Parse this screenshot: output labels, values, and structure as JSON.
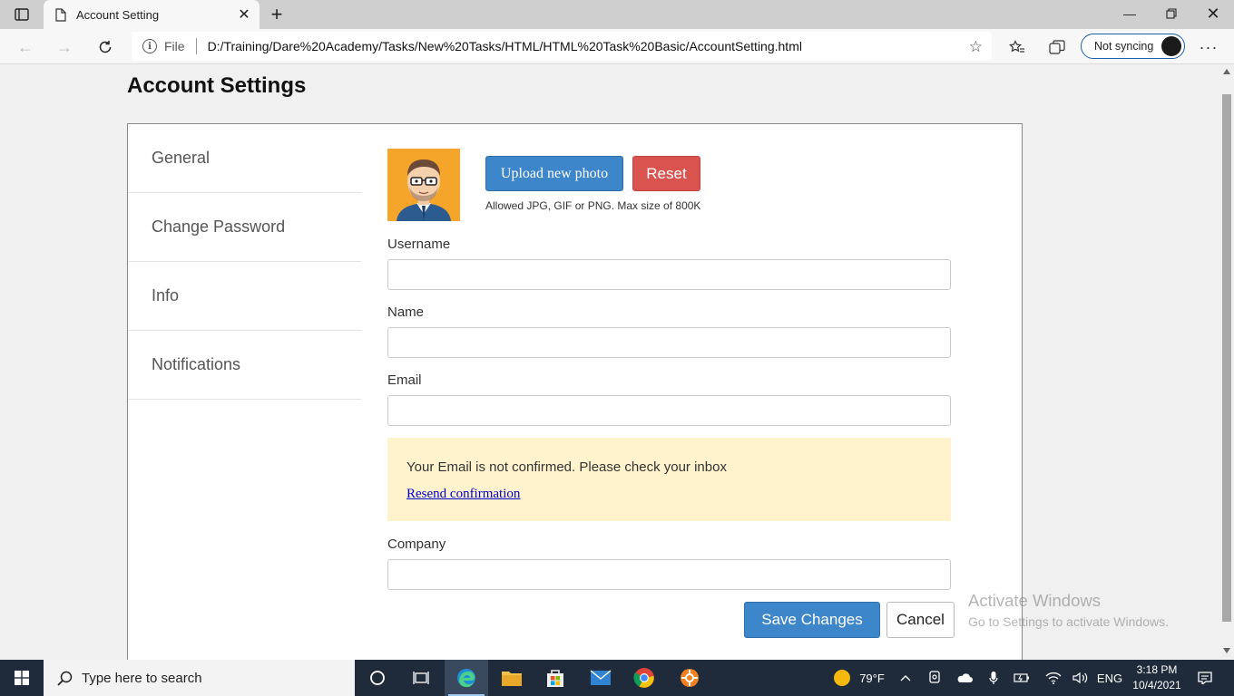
{
  "browser": {
    "tab_title": "Account Setting",
    "url_scheme": "File",
    "url": "D:/Training/Dare%20Academy/Tasks/New%20Tasks/HTML/HTML%20Task%20Basic/AccountSetting.html",
    "sync_label": "Not syncing"
  },
  "page": {
    "title": "Account Settings",
    "sidebar": {
      "items": [
        {
          "label": "General"
        },
        {
          "label": "Change Password"
        },
        {
          "label": "Info"
        },
        {
          "label": "Notifications"
        }
      ]
    },
    "photo": {
      "upload_label": "Upload new photo",
      "reset_label": "Reset",
      "hint": "Allowed JPG, GIF or PNG. Max size of 800K"
    },
    "form": {
      "username_label": "Username",
      "username_value": "",
      "name_label": "Name",
      "name_value": "",
      "email_label": "Email",
      "email_value": "",
      "company_label": "Company",
      "company_value": ""
    },
    "alert": {
      "text": "Your Email is not confirmed. Please check your inbox",
      "link": "Resend confirmation"
    },
    "actions": {
      "save_label": "Save Changes",
      "cancel_label": "Cancel"
    }
  },
  "watermark": {
    "title": "Activate Windows",
    "subtitle": "Go to Settings to activate Windows."
  },
  "taskbar": {
    "search_placeholder": "Type here to search",
    "weather": "79°F",
    "language": "ENG",
    "time": "3:18 PM",
    "date": "10/4/2021"
  },
  "colors": {
    "primary": "#3d86c9",
    "danger": "#d9534f",
    "alert_bg": "#fff3cd",
    "taskbar": "#1f2b3a"
  }
}
